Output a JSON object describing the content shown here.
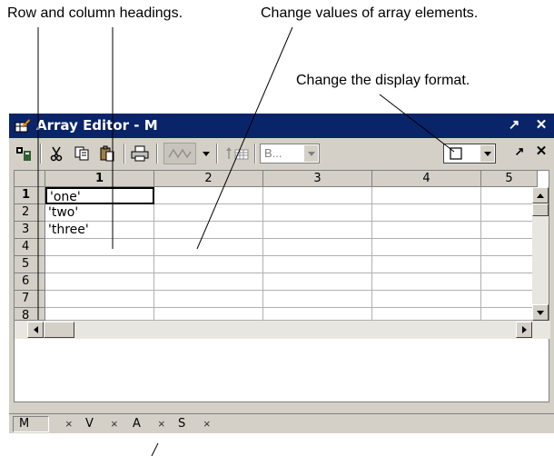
{
  "callouts": {
    "headings": "Row and column headings.",
    "values": "Change values of array elements.",
    "format": "Change the display format."
  },
  "window": {
    "title": "Array Editor - M",
    "restore_label": "↗",
    "close_label": "✕"
  },
  "toolbar": {
    "icons": [
      "import-data-icon",
      "cut-icon",
      "copy-icon",
      "paste-icon",
      "print-icon",
      "plot-icon",
      "dropdown-arrow-icon",
      "size-icon",
      "format-dropdown-icon"
    ],
    "combo_value": "B...",
    "undock_label": "↗",
    "close_label": "✕"
  },
  "grid": {
    "columns": [
      "1",
      "2",
      "3",
      "4",
      "5"
    ],
    "rows": [
      "1",
      "2",
      "3",
      "4",
      "5",
      "6",
      "7",
      "8"
    ],
    "cells": [
      [
        "'one'"
      ],
      [
        "'two'"
      ],
      [
        "'three'"
      ]
    ]
  },
  "tabs": [
    {
      "label": "M",
      "close": "×"
    },
    {
      "label": "V",
      "close": "×"
    },
    {
      "label": "A",
      "close": "×"
    },
    {
      "label": "S",
      "close": "×"
    }
  ]
}
